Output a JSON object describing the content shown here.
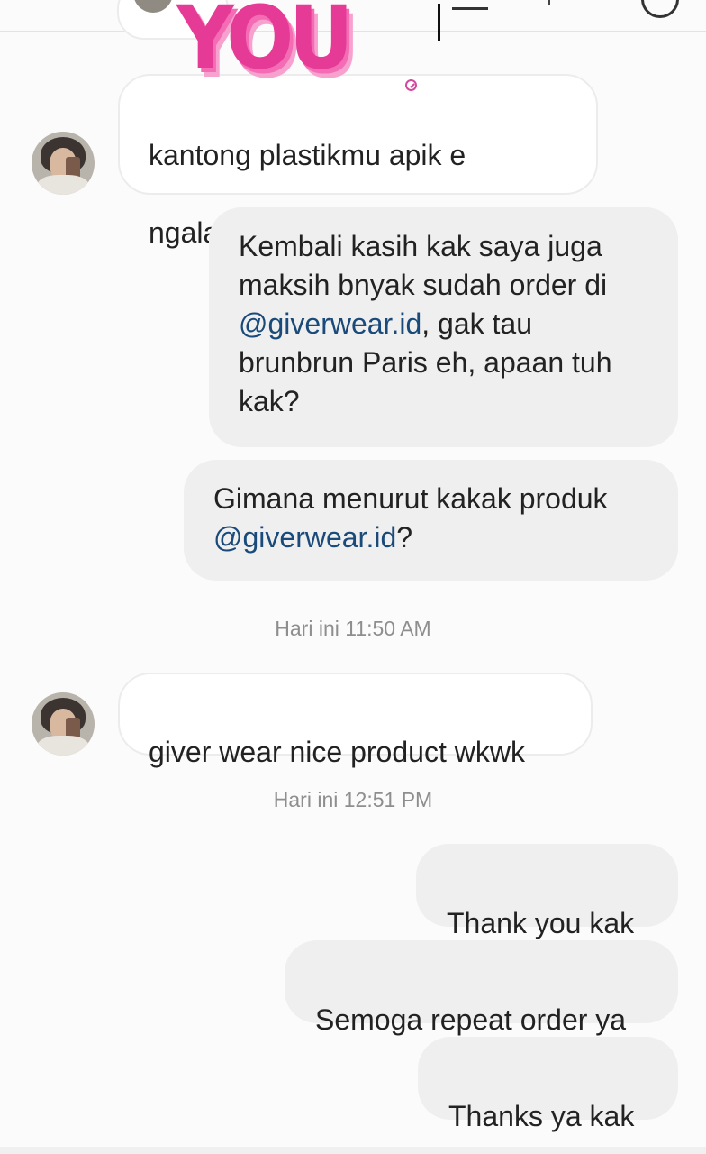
{
  "sticker": {
    "text": "YOU"
  },
  "messages": [
    {
      "direction": "in",
      "text_lines": [
        "kantong plastikmu apik e",
        "ngalah2i brunbrun paris wkwk"
      ]
    },
    {
      "direction": "out",
      "text_before": "Kembali kasih kak saya juga maksih bnyak sudah order di ",
      "mention": "@giverwear.id",
      "text_after": ", gak tau brunbrun Paris eh, apaan tuh kak?"
    },
    {
      "direction": "out",
      "text_before": "Gimana menurut kakak produk ",
      "mention": "@giverwear.id",
      "text_after": "?"
    },
    {
      "direction": "in",
      "text": "giver wear nice product wkwk"
    },
    {
      "direction": "out",
      "text": "Thank you kak"
    },
    {
      "direction": "out",
      "text": "Semoga repeat order ya"
    },
    {
      "direction": "out",
      "text": "Thanks ya kak"
    }
  ],
  "timestamps": [
    "Hari ini 11:50 AM",
    "Hari ini 12:51 PM"
  ],
  "colors": {
    "background": "#fbfbfb",
    "incoming_bubble": "#ffffff",
    "outgoing_bubble": "#efefef",
    "mention": "#1a4a7a",
    "timestamp": "#8e8e8e",
    "sticker": "#e53a96"
  }
}
